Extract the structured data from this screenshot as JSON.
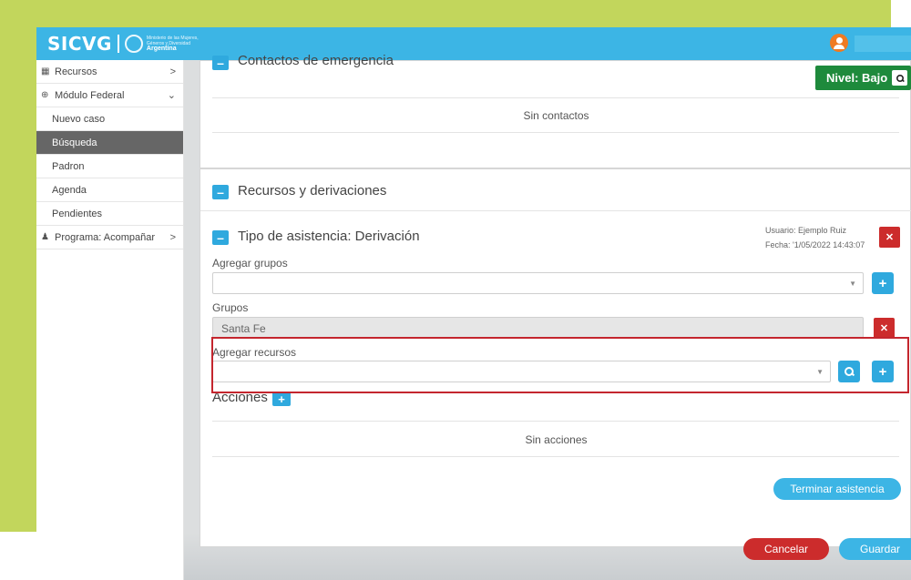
{
  "app": {
    "logo": "SICVG",
    "ministry_line1": "Ministerio de las Mujeres,",
    "ministry_line2": "Géneros y Diversidad",
    "ministry_country": "Argentina"
  },
  "sidebar": {
    "items": [
      {
        "label": "Recursos",
        "icon": "building-icon"
      },
      {
        "label": "Módulo Federal",
        "icon": "globe-icon"
      },
      {
        "label": "Nuevo caso"
      },
      {
        "label": "Búsqueda"
      },
      {
        "label": "Padron"
      },
      {
        "label": "Agenda"
      },
      {
        "label": "Pendientes"
      },
      {
        "label": "Programa: Acompañar",
        "icon": "person-icon"
      }
    ]
  },
  "risk": {
    "label": "Nivel: Bajo"
  },
  "contacts": {
    "title": "Contactos de emergencia",
    "empty": "Sin contactos"
  },
  "resources": {
    "title": "Recursos y derivaciones",
    "assistance_title": "Tipo de asistencia: Derivación",
    "user": "Usuario: Ejemplo Ruiz",
    "date": "Fecha: '1/05/2022 14:43:07",
    "add_groups_label": "Agregar grupos",
    "groups_label": "Grupos",
    "group_value": "Santa Fe",
    "add_resources_label": "Agregar recursos",
    "actions_label": "Acciones",
    "actions_empty": "Sin acciones",
    "finish_button": "Terminar asistencia"
  },
  "footer": {
    "cancel": "Cancelar",
    "save": "Guardar"
  },
  "colors": {
    "accent": "#3cb5e5",
    "danger": "#cc2c2c",
    "success": "#1e8a3c",
    "frame": "#c2d65c"
  }
}
